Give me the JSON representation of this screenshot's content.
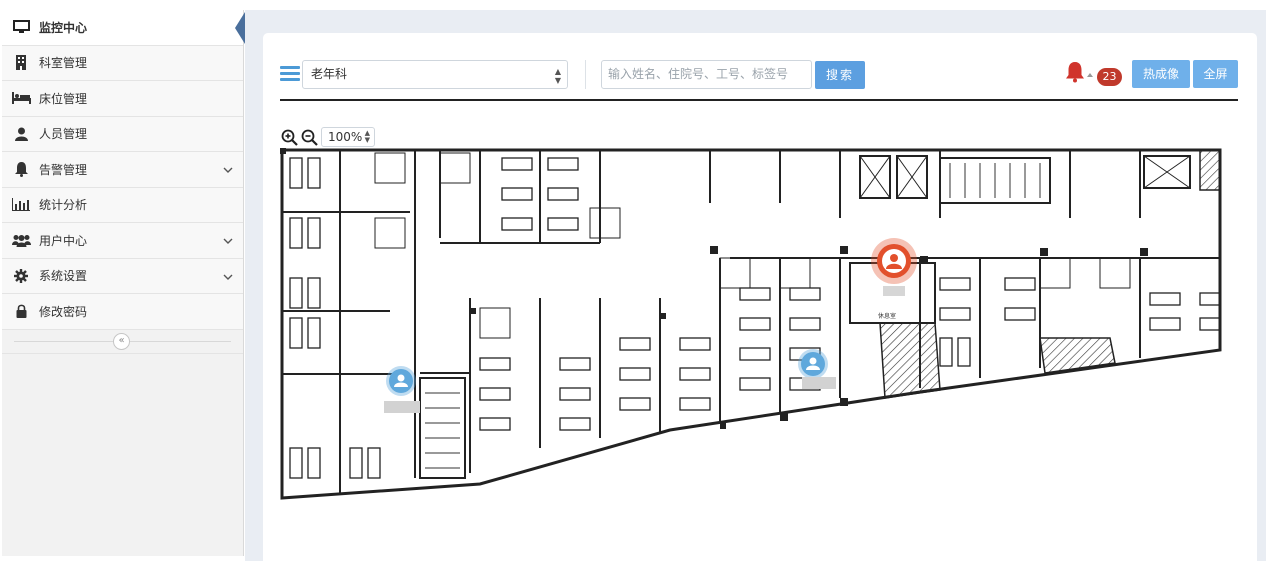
{
  "sidebar": {
    "items": [
      {
        "label": "监控中心",
        "icon": "monitor-icon",
        "active": true
      },
      {
        "label": "科室管理",
        "icon": "building-icon"
      },
      {
        "label": "床位管理",
        "icon": "bed-icon"
      },
      {
        "label": "人员管理",
        "icon": "user-icon"
      },
      {
        "label": "告警管理",
        "icon": "bell-icon",
        "expandable": true
      },
      {
        "label": "统计分析",
        "icon": "bar-chart-icon"
      },
      {
        "label": "用户中心",
        "icon": "users-icon",
        "expandable": true
      },
      {
        "label": "系统设置",
        "icon": "gear-icon",
        "expandable": true
      },
      {
        "label": "修改密码",
        "icon": "lock-icon"
      }
    ],
    "collapse_glyph": "«"
  },
  "toolbar": {
    "department": "老年科",
    "search_placeholder": "输入姓名、住院号、工号、标签号",
    "search_label": "搜索",
    "alert_count": "23",
    "thermal_label": "热成像",
    "fullscreen_label": "全屏"
  },
  "map": {
    "zoom": "100%",
    "room_label": "休息室",
    "staff_markers": [
      {
        "status": "alert",
        "color": "#e2502c"
      },
      {
        "status": "normal",
        "color": "#5fa8dc"
      },
      {
        "status": "normal",
        "color": "#5fa8dc"
      }
    ]
  },
  "colors": {
    "accent": "#5c9fe0",
    "badge": "#c0392b",
    "active_pointer": "#4a6f9c"
  }
}
